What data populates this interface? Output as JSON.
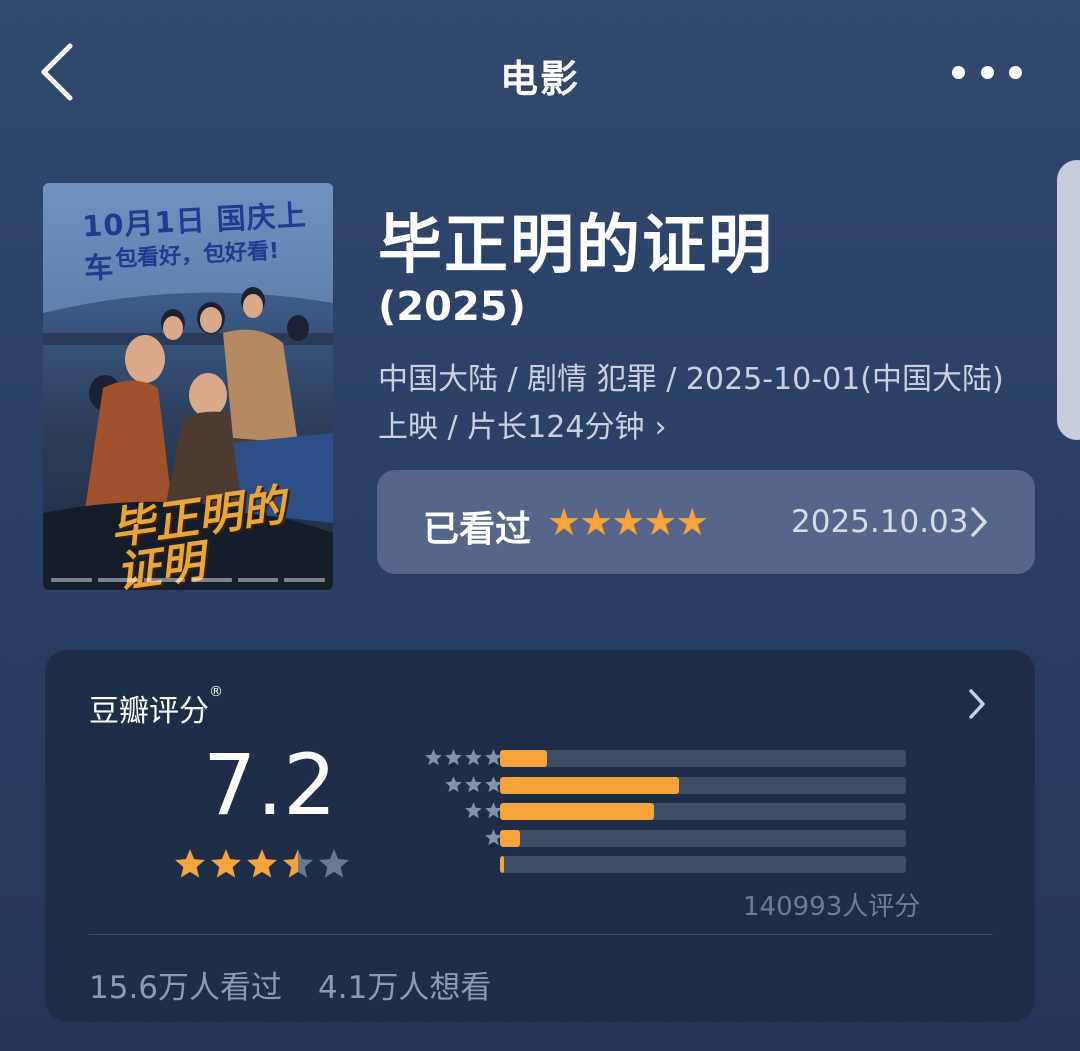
{
  "header": {
    "title": "电影"
  },
  "movie": {
    "poster": {
      "banner": "10月1日 国庆上车",
      "slogan": "包看好，包好看!",
      "title": "毕正明的证明"
    },
    "title": "毕正明的证明",
    "year": "(2025)",
    "info_line1": "中国大陆 / 剧情 犯罪 / 2025-10-01(中国大陆)",
    "info_line2": "上映 / 片长124分钟"
  },
  "watched": {
    "label": "已看过",
    "stars": "★★★★★",
    "user_rating": 5,
    "date": "2025.10.03"
  },
  "douban_rating": {
    "heading": "豆瓣评分",
    "registered_mark": "®",
    "score": "7.2",
    "star_rating": 3.5,
    "distribution": [
      {
        "stars": 5,
        "fraction": 0.115
      },
      {
        "stars": 4,
        "fraction": 0.44
      },
      {
        "stars": 3,
        "fraction": 0.38
      },
      {
        "stars": 2,
        "fraction": 0.05
      },
      {
        "stars": 1,
        "fraction": 0.01
      }
    ],
    "rating_count": "140993人评分",
    "watched_count": "15.6万人看过",
    "wish_count": "4.1万人想看"
  },
  "colors": {
    "accent": "#f5a33a",
    "background": "#2a4066",
    "card": "#1f2e48",
    "watched_card": "#55668a"
  }
}
